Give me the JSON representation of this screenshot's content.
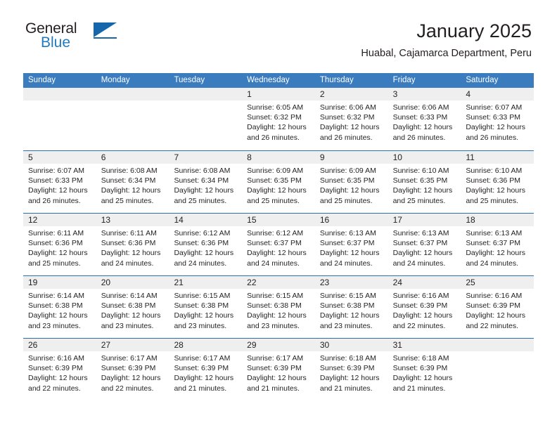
{
  "brand": {
    "name_part1": "General",
    "name_part2": "Blue",
    "accent_color": "#1566ab",
    "logo_icon": "triangle-flag-icon"
  },
  "header": {
    "title": "January 2025",
    "subtitle": "Huabal, Cajamarca Department, Peru"
  },
  "colors": {
    "header_row_bg": "#3a7cbe",
    "day_band_bg": "#efeff0",
    "row_divider": "#2e6fae",
    "text": "#231f20"
  },
  "weekdays": [
    "Sunday",
    "Monday",
    "Tuesday",
    "Wednesday",
    "Thursday",
    "Friday",
    "Saturday"
  ],
  "weeks": [
    [
      {
        "day": "",
        "sunrise": "",
        "sunset": "",
        "daylight_line1": "",
        "daylight_line2": ""
      },
      {
        "day": "",
        "sunrise": "",
        "sunset": "",
        "daylight_line1": "",
        "daylight_line2": ""
      },
      {
        "day": "",
        "sunrise": "",
        "sunset": "",
        "daylight_line1": "",
        "daylight_line2": ""
      },
      {
        "day": "1",
        "sunrise": "Sunrise: 6:05 AM",
        "sunset": "Sunset: 6:32 PM",
        "daylight_line1": "Daylight: 12 hours",
        "daylight_line2": "and 26 minutes."
      },
      {
        "day": "2",
        "sunrise": "Sunrise: 6:06 AM",
        "sunset": "Sunset: 6:32 PM",
        "daylight_line1": "Daylight: 12 hours",
        "daylight_line2": "and 26 minutes."
      },
      {
        "day": "3",
        "sunrise": "Sunrise: 6:06 AM",
        "sunset": "Sunset: 6:33 PM",
        "daylight_line1": "Daylight: 12 hours",
        "daylight_line2": "and 26 minutes."
      },
      {
        "day": "4",
        "sunrise": "Sunrise: 6:07 AM",
        "sunset": "Sunset: 6:33 PM",
        "daylight_line1": "Daylight: 12 hours",
        "daylight_line2": "and 26 minutes."
      }
    ],
    [
      {
        "day": "5",
        "sunrise": "Sunrise: 6:07 AM",
        "sunset": "Sunset: 6:33 PM",
        "daylight_line1": "Daylight: 12 hours",
        "daylight_line2": "and 26 minutes."
      },
      {
        "day": "6",
        "sunrise": "Sunrise: 6:08 AM",
        "sunset": "Sunset: 6:34 PM",
        "daylight_line1": "Daylight: 12 hours",
        "daylight_line2": "and 25 minutes."
      },
      {
        "day": "7",
        "sunrise": "Sunrise: 6:08 AM",
        "sunset": "Sunset: 6:34 PM",
        "daylight_line1": "Daylight: 12 hours",
        "daylight_line2": "and 25 minutes."
      },
      {
        "day": "8",
        "sunrise": "Sunrise: 6:09 AM",
        "sunset": "Sunset: 6:35 PM",
        "daylight_line1": "Daylight: 12 hours",
        "daylight_line2": "and 25 minutes."
      },
      {
        "day": "9",
        "sunrise": "Sunrise: 6:09 AM",
        "sunset": "Sunset: 6:35 PM",
        "daylight_line1": "Daylight: 12 hours",
        "daylight_line2": "and 25 minutes."
      },
      {
        "day": "10",
        "sunrise": "Sunrise: 6:10 AM",
        "sunset": "Sunset: 6:35 PM",
        "daylight_line1": "Daylight: 12 hours",
        "daylight_line2": "and 25 minutes."
      },
      {
        "day": "11",
        "sunrise": "Sunrise: 6:10 AM",
        "sunset": "Sunset: 6:36 PM",
        "daylight_line1": "Daylight: 12 hours",
        "daylight_line2": "and 25 minutes."
      }
    ],
    [
      {
        "day": "12",
        "sunrise": "Sunrise: 6:11 AM",
        "sunset": "Sunset: 6:36 PM",
        "daylight_line1": "Daylight: 12 hours",
        "daylight_line2": "and 25 minutes."
      },
      {
        "day": "13",
        "sunrise": "Sunrise: 6:11 AM",
        "sunset": "Sunset: 6:36 PM",
        "daylight_line1": "Daylight: 12 hours",
        "daylight_line2": "and 24 minutes."
      },
      {
        "day": "14",
        "sunrise": "Sunrise: 6:12 AM",
        "sunset": "Sunset: 6:36 PM",
        "daylight_line1": "Daylight: 12 hours",
        "daylight_line2": "and 24 minutes."
      },
      {
        "day": "15",
        "sunrise": "Sunrise: 6:12 AM",
        "sunset": "Sunset: 6:37 PM",
        "daylight_line1": "Daylight: 12 hours",
        "daylight_line2": "and 24 minutes."
      },
      {
        "day": "16",
        "sunrise": "Sunrise: 6:13 AM",
        "sunset": "Sunset: 6:37 PM",
        "daylight_line1": "Daylight: 12 hours",
        "daylight_line2": "and 24 minutes."
      },
      {
        "day": "17",
        "sunrise": "Sunrise: 6:13 AM",
        "sunset": "Sunset: 6:37 PM",
        "daylight_line1": "Daylight: 12 hours",
        "daylight_line2": "and 24 minutes."
      },
      {
        "day": "18",
        "sunrise": "Sunrise: 6:13 AM",
        "sunset": "Sunset: 6:37 PM",
        "daylight_line1": "Daylight: 12 hours",
        "daylight_line2": "and 24 minutes."
      }
    ],
    [
      {
        "day": "19",
        "sunrise": "Sunrise: 6:14 AM",
        "sunset": "Sunset: 6:38 PM",
        "daylight_line1": "Daylight: 12 hours",
        "daylight_line2": "and 23 minutes."
      },
      {
        "day": "20",
        "sunrise": "Sunrise: 6:14 AM",
        "sunset": "Sunset: 6:38 PM",
        "daylight_line1": "Daylight: 12 hours",
        "daylight_line2": "and 23 minutes."
      },
      {
        "day": "21",
        "sunrise": "Sunrise: 6:15 AM",
        "sunset": "Sunset: 6:38 PM",
        "daylight_line1": "Daylight: 12 hours",
        "daylight_line2": "and 23 minutes."
      },
      {
        "day": "22",
        "sunrise": "Sunrise: 6:15 AM",
        "sunset": "Sunset: 6:38 PM",
        "daylight_line1": "Daylight: 12 hours",
        "daylight_line2": "and 23 minutes."
      },
      {
        "day": "23",
        "sunrise": "Sunrise: 6:15 AM",
        "sunset": "Sunset: 6:38 PM",
        "daylight_line1": "Daylight: 12 hours",
        "daylight_line2": "and 23 minutes."
      },
      {
        "day": "24",
        "sunrise": "Sunrise: 6:16 AM",
        "sunset": "Sunset: 6:39 PM",
        "daylight_line1": "Daylight: 12 hours",
        "daylight_line2": "and 22 minutes."
      },
      {
        "day": "25",
        "sunrise": "Sunrise: 6:16 AM",
        "sunset": "Sunset: 6:39 PM",
        "daylight_line1": "Daylight: 12 hours",
        "daylight_line2": "and 22 minutes."
      }
    ],
    [
      {
        "day": "26",
        "sunrise": "Sunrise: 6:16 AM",
        "sunset": "Sunset: 6:39 PM",
        "daylight_line1": "Daylight: 12 hours",
        "daylight_line2": "and 22 minutes."
      },
      {
        "day": "27",
        "sunrise": "Sunrise: 6:17 AM",
        "sunset": "Sunset: 6:39 PM",
        "daylight_line1": "Daylight: 12 hours",
        "daylight_line2": "and 22 minutes."
      },
      {
        "day": "28",
        "sunrise": "Sunrise: 6:17 AM",
        "sunset": "Sunset: 6:39 PM",
        "daylight_line1": "Daylight: 12 hours",
        "daylight_line2": "and 21 minutes."
      },
      {
        "day": "29",
        "sunrise": "Sunrise: 6:17 AM",
        "sunset": "Sunset: 6:39 PM",
        "daylight_line1": "Daylight: 12 hours",
        "daylight_line2": "and 21 minutes."
      },
      {
        "day": "30",
        "sunrise": "Sunrise: 6:18 AM",
        "sunset": "Sunset: 6:39 PM",
        "daylight_line1": "Daylight: 12 hours",
        "daylight_line2": "and 21 minutes."
      },
      {
        "day": "31",
        "sunrise": "Sunrise: 6:18 AM",
        "sunset": "Sunset: 6:39 PM",
        "daylight_line1": "Daylight: 12 hours",
        "daylight_line2": "and 21 minutes."
      },
      {
        "day": "",
        "sunrise": "",
        "sunset": "",
        "daylight_line1": "",
        "daylight_line2": ""
      }
    ]
  ]
}
